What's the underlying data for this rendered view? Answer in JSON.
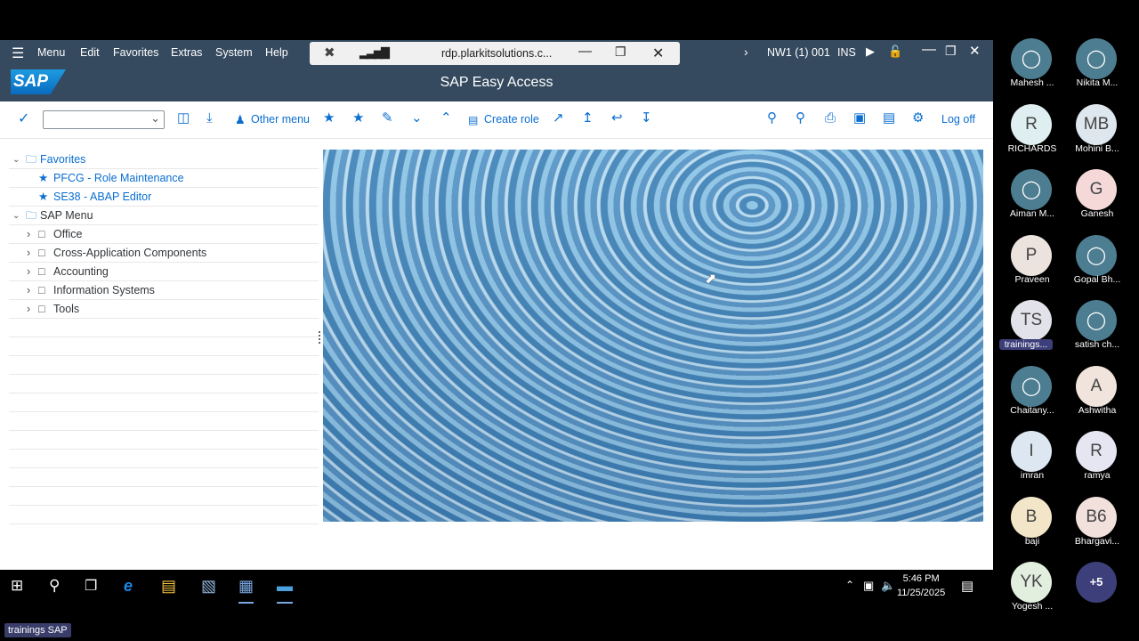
{
  "menu": {
    "items": [
      "Menu",
      "Edit",
      "Favorites",
      "Extras",
      "System",
      "Help"
    ]
  },
  "rdp_bar": {
    "host": "rdp.plarkitsolutions.c..."
  },
  "system_info": {
    "sid": "NW1 (1) 001",
    "mode": "INS"
  },
  "app": {
    "title": "SAP Easy Access",
    "logo_text": "SAP"
  },
  "toolbar": {
    "other_menu": "Other menu",
    "create_role": "Create role",
    "log_off": "Log off",
    "command_value": ""
  },
  "tree": {
    "favorites_label": "Favorites",
    "favorites": [
      "PFCG - Role Maintenance",
      "SE38 - ABAP Editor"
    ],
    "sap_menu_label": "SAP Menu",
    "sap_menu": [
      "Office",
      "Cross-Application Components",
      "Accounting",
      "Information Systems",
      "Tools"
    ]
  },
  "taskbar": {
    "time": "5:46 PM",
    "date": "11/25/2025"
  },
  "participants": [
    {
      "initials": "",
      "name": "Mahesh ...",
      "color": "#4d7d90",
      "icon": "person-icon"
    },
    {
      "initials": "",
      "name": "Nikita M...",
      "color": "#4d7d90",
      "icon": "person-icon"
    },
    {
      "initials": "R",
      "name": "RICHARDS",
      "color": "#dfeef0"
    },
    {
      "initials": "MB",
      "name": "Mohini B...",
      "color": "#dde7ed"
    },
    {
      "initials": "",
      "name": "Aiman M...",
      "color": "#4d7d90",
      "icon": "person-icon"
    },
    {
      "initials": "G",
      "name": "Ganesh",
      "color": "#f5d9d9"
    },
    {
      "initials": "P",
      "name": "Praveen",
      "color": "#ece2de"
    },
    {
      "initials": "",
      "name": "Gopal Bh...",
      "color": "#4d7d90",
      "icon": "person-icon"
    },
    {
      "initials": "TS",
      "name": "trainings...",
      "color": "#e2e2ea",
      "highlight": true
    },
    {
      "initials": "",
      "name": "satish ch...",
      "color": "#4d7d90",
      "icon": "person-icon"
    },
    {
      "initials": "",
      "name": "Chaitany...",
      "color": "#4d7d90",
      "icon": "person-icon"
    },
    {
      "initials": "A",
      "name": "Ashwitha",
      "color": "#f0e4dc"
    },
    {
      "initials": "I",
      "name": "imran",
      "color": "#dde7f2"
    },
    {
      "initials": "R",
      "name": "ramya",
      "color": "#e6e6f2"
    },
    {
      "initials": "B",
      "name": "baji",
      "color": "#f3e6c8"
    },
    {
      "initials": "B6",
      "name": "Bhargavi...",
      "color": "#f2e0dc"
    },
    {
      "initials": "YK",
      "name": "Yogesh ...",
      "color": "#e2efdf"
    },
    {
      "initials": "+5",
      "name": "",
      "color": "#3d3f7a"
    }
  ],
  "meeting_tag": "trainings SAP"
}
